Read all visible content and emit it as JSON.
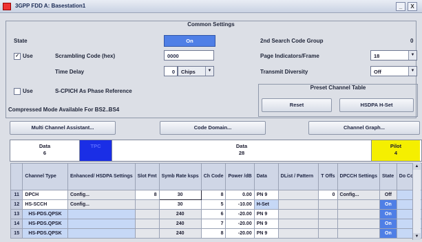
{
  "window": {
    "title": "3GPP FDD A: Basestation1",
    "close_label": "X"
  },
  "common": {
    "header": "Common Settings",
    "state_label": "State",
    "state_value": "On",
    "use_label": "Use",
    "scrambling_label": "Scrambling Code (hex)",
    "scrambling_value": "0000",
    "time_delay_label": "Time Delay",
    "time_delay_value": "0",
    "time_delay_unit": "Chips",
    "scpich_use_label": "Use",
    "scpich_label": "S-CPICH As Phase Reference",
    "compressed_label": "Compressed Mode Available For BS2..BS4",
    "search_group_label": "2nd Search Code Group",
    "search_group_value": "0",
    "page_ind_label": "Page Indicators/Frame",
    "page_ind_value": "18",
    "tx_div_label": "Transmit Diversity",
    "tx_div_value": "Off"
  },
  "preset": {
    "header": "Preset Channel Table",
    "reset_label": "Reset",
    "hsdpa_label": "HSDPA H-Set"
  },
  "toolbar": {
    "multi_label": "Multi Channel Assistant...",
    "code_domain_label": "Code Domain...",
    "channel_graph_label": "Channel Graph..."
  },
  "slots": [
    {
      "name": "Data",
      "value": "6"
    },
    {
      "name": "TPC",
      "value": ""
    },
    {
      "name": "Data",
      "value": "28"
    },
    {
      "name": "Pilot",
      "value": "4"
    }
  ],
  "colors": {
    "tpc": "#1a2ee6",
    "pilot": "#f5ef00",
    "state_on": "#4f7fe6"
  },
  "table": {
    "headers": [
      "",
      "Channel Type",
      "Enhanced/ HSDPA Settings",
      "Slot Fmt",
      "Symb Rate ksps",
      "Ch Code",
      "Power /dB",
      "Data",
      "DList / Pattern",
      "T Offs",
      "DPCCH Settings",
      "State",
      "Do Co nf"
    ],
    "rows": [
      [
        "11",
        "DPCH",
        "Config...",
        "8",
        "30",
        "8",
        "0.00",
        "PN 9",
        "",
        "0",
        "Config...",
        "Off",
        ""
      ],
      [
        "12",
        "HS-SCCH",
        "Config...",
        "",
        "30",
        "5",
        "-10.00",
        "H-Set",
        "",
        "",
        "",
        "On",
        ""
      ],
      [
        "13",
        "HS-PDS.QPSK",
        "",
        "",
        "240",
        "6",
        "-20.00",
        "PN 9",
        "",
        "",
        "",
        "On",
        ""
      ],
      [
        "14",
        "HS-PDS.QPSK",
        "",
        "",
        "240",
        "7",
        "-20.00",
        "PN 9",
        "",
        "",
        "",
        "On",
        ""
      ],
      [
        "15",
        "HS-PDS.QPSK",
        "",
        "",
        "240",
        "8",
        "-20.00",
        "PN 9",
        "",
        "",
        "",
        "On",
        ""
      ]
    ]
  }
}
